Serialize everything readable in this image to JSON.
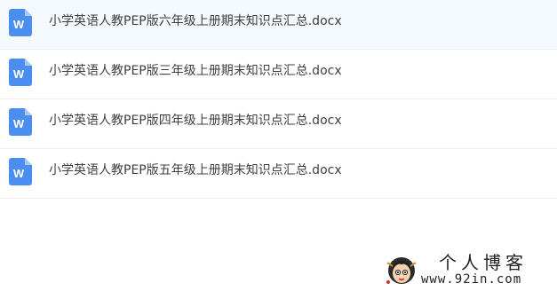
{
  "files": [
    {
      "name": "小学英语人教PEP版六年级上册期末知识点汇总.docx",
      "icon": "word-doc-icon",
      "selected": true
    },
    {
      "name": "小学英语人教PEP版三年级上册期末知识点汇总.docx",
      "icon": "word-doc-icon",
      "selected": false
    },
    {
      "name": "小学英语人教PEP版四年级上册期末知识点汇总.docx",
      "icon": "word-doc-icon",
      "selected": false
    },
    {
      "name": "小学英语人教PEP版五年级上册期末知识点汇总.docx",
      "icon": "word-doc-icon",
      "selected": false
    }
  ],
  "watermark": {
    "title": "个人博客",
    "url": "www.92in.com"
  },
  "colors": {
    "word_blue": "#4a8ef0",
    "selected_row_bg": "#f4f9fd",
    "text": "#3c3f44"
  }
}
